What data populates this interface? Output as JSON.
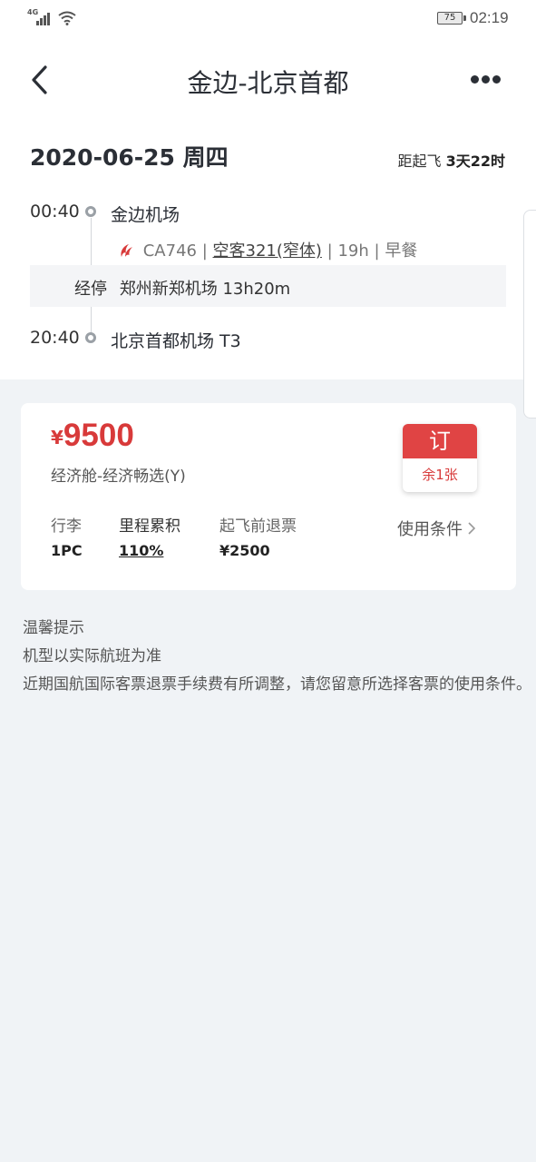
{
  "status_bar": {
    "network": "4G",
    "battery": "75",
    "time": "02:19"
  },
  "nav": {
    "title": "金边-北京首都",
    "back_icon": "chevron-left-icon",
    "more_icon": "more-dots-icon"
  },
  "date_row": {
    "date": "2020-06-25 周四",
    "countdown_label": "距起飞",
    "countdown_value": "3天22时"
  },
  "itinerary": {
    "departure": {
      "time": "00:40",
      "airport": "金边机场"
    },
    "flight": {
      "number": "CA746",
      "aircraft": "空客321(窄体)",
      "duration": "19h",
      "meal": "早餐",
      "sep": "|"
    },
    "stopover": {
      "label": "经停",
      "airport": "郑州新郑机场",
      "duration": "13h20m"
    },
    "arrival": {
      "time": "20:40",
      "airport": "北京首都机场 T3"
    }
  },
  "fare": {
    "currency": "¥",
    "price": "9500",
    "cabin": "经济舱-经济畅选(Y)",
    "book_label": "订",
    "remaining": "余1张",
    "attributes": [
      {
        "label": "行李",
        "value": "1PC"
      },
      {
        "label": "里程累积",
        "value": "110%"
      },
      {
        "label": "起飞前退票",
        "value": "¥2500"
      }
    ],
    "rules_link": "使用条件"
  },
  "tips": {
    "title": "温馨提示",
    "lines": [
      "机型以实际航班为准",
      "近期国航国际客票退票手续费有所调整，请您留意所选择客票的使用条件。"
    ]
  },
  "colors": {
    "accent_red": "#d83a3a",
    "book_red": "#e04444",
    "page_bg": "#f0f3f6"
  }
}
